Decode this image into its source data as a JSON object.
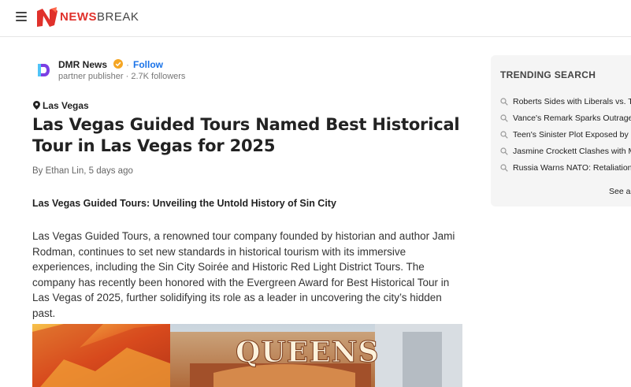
{
  "header": {
    "brand_bold": "NEWS",
    "brand_light": "BREAK",
    "accent_color": "#e0312b"
  },
  "publisher": {
    "name": "DMR News",
    "follow_label": "Follow",
    "separator": "·",
    "meta": "partner publisher · 2.7K followers",
    "verified_color": "#f5a623",
    "link_color": "#1a73e8"
  },
  "article": {
    "location": "Las Vegas",
    "title": "Las Vegas Guided Tours Named Best Historical Tour in Las Vegas for 2025",
    "byline": "By Ethan Lin, 5 days ago",
    "subheading": "Las Vegas Guided Tours: Unveiling the Untold History of Sin City",
    "body": "Las Vegas Guided Tours, a renowned tour company founded by historian and author Jami Rodman, continues to set new standards in historical tourism with its immersive experiences, including the Sin City Soirée and Historic Red Light District Tours. The company has recently been honored with the Evergreen Award for Best Historical Tour in Las Vegas of 2025, further solidifying its role as a leader in uncovering the city’s hidden past.",
    "image_sign": "QUEENS"
  },
  "sidebar": {
    "title": "TRENDING SEARCH",
    "items": [
      "Roberts Sides with Liberals vs. Tr",
      "Vance's Remark Sparks Outrage",
      "Teen's Sinister Plot Exposed by F",
      "Jasmine Crockett Clashes with M",
      "Russia Warns NATO: Retaliation"
    ],
    "see_all": "See al"
  }
}
